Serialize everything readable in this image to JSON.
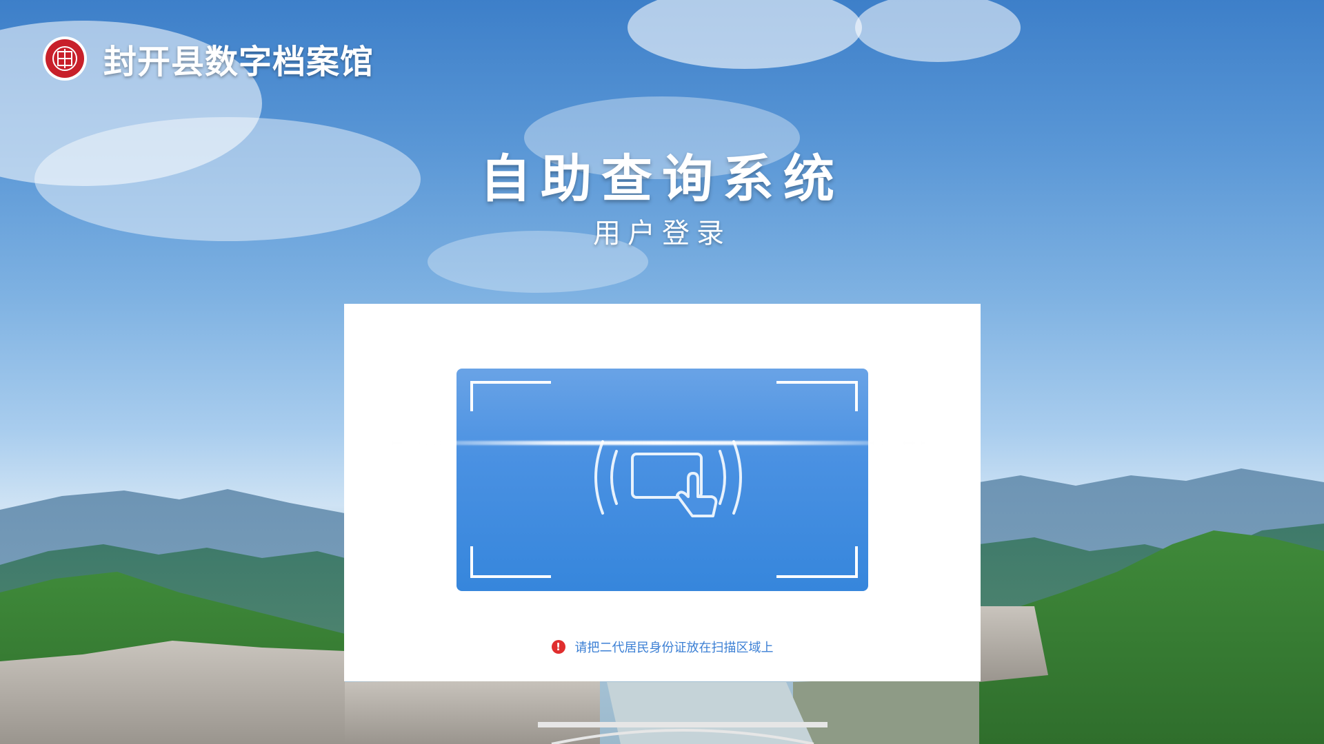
{
  "header": {
    "site_title": "封开县数字档案馆",
    "logo_icon": "archive-seal-icon"
  },
  "main": {
    "title": "自助查询系统",
    "subtitle": "用户登录"
  },
  "scanner": {
    "icon": "id-card-tap-icon",
    "hint_icon": "exclamation-circle-icon",
    "hint": "请把二代居民身份证放在扫描区域上"
  },
  "colors": {
    "scan_blue": "#4a91e2",
    "hint_text": "#3b7fd4",
    "alert_red": "#e02e2e",
    "logo_red": "#c8202a"
  }
}
